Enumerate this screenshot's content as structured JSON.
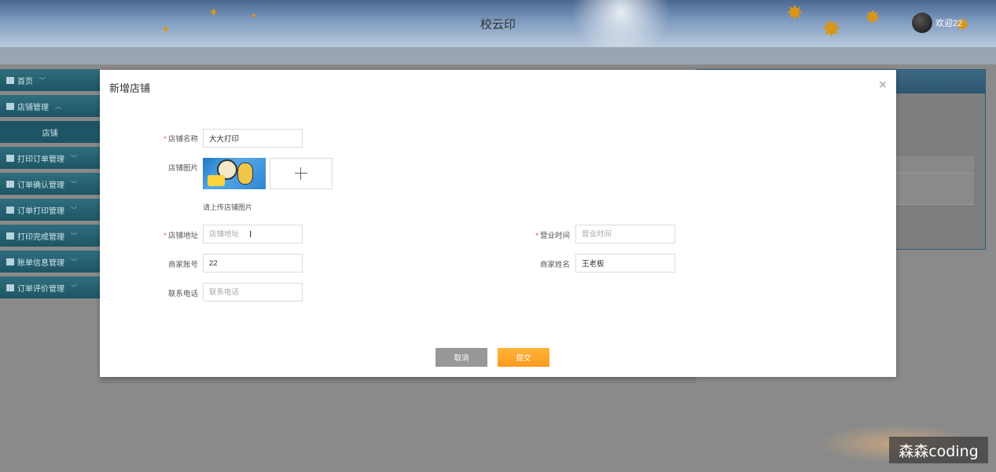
{
  "header": {
    "title": "校云印",
    "welcome": "欢迎22"
  },
  "sidebar": {
    "items": [
      {
        "label": "首页",
        "icon": "home-icon"
      },
      {
        "label": "店铺管理",
        "icon": "store-icon"
      },
      {
        "label": "店铺",
        "icon": ""
      },
      {
        "label": "打印订单管理",
        "icon": "orders-icon"
      },
      {
        "label": "订单确认管理",
        "icon": "confirm-icon"
      },
      {
        "label": "订单打印管理",
        "icon": "print-icon"
      },
      {
        "label": "打印完成管理",
        "icon": "done-icon"
      },
      {
        "label": "账单信息管理",
        "icon": "bill-icon"
      },
      {
        "label": "订单评价管理",
        "icon": "review-icon"
      }
    ]
  },
  "modal": {
    "title": "新增店铺",
    "close": "×",
    "fields": {
      "shop_name": {
        "label": "店铺名称",
        "value": "大大打印",
        "required": true
      },
      "shop_image": {
        "label": "店铺图片",
        "hint": "请上传店铺图片"
      },
      "shop_address": {
        "label": "店铺地址",
        "placeholder": "店铺地址",
        "required": true
      },
      "business_hours": {
        "label": "营业时间",
        "placeholder": "营业时间",
        "required": true
      },
      "merchant_account": {
        "label": "商家账号",
        "value": "22"
      },
      "merchant_name": {
        "label": "商家姓名",
        "value": "王老板"
      },
      "phone": {
        "label": "联系电话",
        "placeholder": "联系电话"
      }
    },
    "buttons": {
      "cancel": "取消",
      "submit": "提交"
    }
  },
  "watermark": "森森coding",
  "colors": {
    "submit": "#ff9a1e",
    "cancel": "#989898",
    "required": "#e5484d",
    "sidebar": "#1e5565"
  }
}
